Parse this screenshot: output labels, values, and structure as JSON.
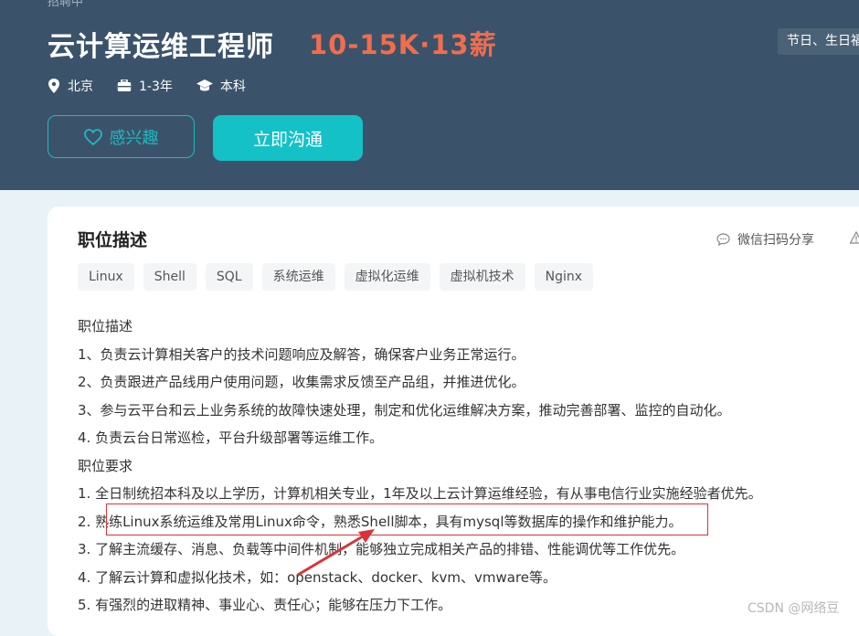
{
  "header": {
    "cut_text": "招聘中",
    "job_title": "云计算运维工程师",
    "salary": "10-15K·13薪",
    "perk_tag": "节日、生日福利",
    "meta": {
      "location": "北京",
      "experience": "1-3年",
      "education": "本科"
    },
    "interest_button": "感兴趣",
    "chat_button": "立即沟通"
  },
  "card": {
    "title": "职位描述",
    "share_label": "微信扫码分享",
    "tags": [
      "Linux",
      "Shell",
      "SQL",
      "系统运维",
      "虚拟化运维",
      "虚拟机技术",
      "Nginx"
    ],
    "lines": [
      "职位描述",
      "1、负责云计算相关客户的技术问题响应及解答，确保客户业务正常运行。",
      "2、负责跟进产品线用户使用问题，收集需求反馈至产品组，并推进优化。",
      "3、参与云平台和云上业务系统的故障快速处理，制定和优化运维解决方案，推动完善部署、监控的自动化。",
      "4. 负责云台日常巡检，平台升级部署等运维工作。",
      "职位要求",
      "1. 全日制统招本科及以上学历，计算机相关专业，1年及以上云计算运维经验，有从事电信行业实施经验者优先。",
      "2. 熟练Linux系统运维及常用Linux命令，熟悉Shell脚本，具有mysql等数据库的操作和维护能力。",
      "3. 了解主流缓存、消息、负载等中间件机制，能够独立完成相关产品的排错、性能调优等工作优先。",
      "4. 了解云计算和虚拟化技术，如：openstack、docker、kvm、vmware等。",
      "5. 有强烈的进取精神、事业心、责任心；能够在压力下工作。"
    ]
  },
  "watermark": "CSDN @网络豆",
  "colors": {
    "header_bg": "#3b536a",
    "salary": "#f26d4d",
    "accent": "#14c1c7",
    "annotation": "#d9343b"
  }
}
